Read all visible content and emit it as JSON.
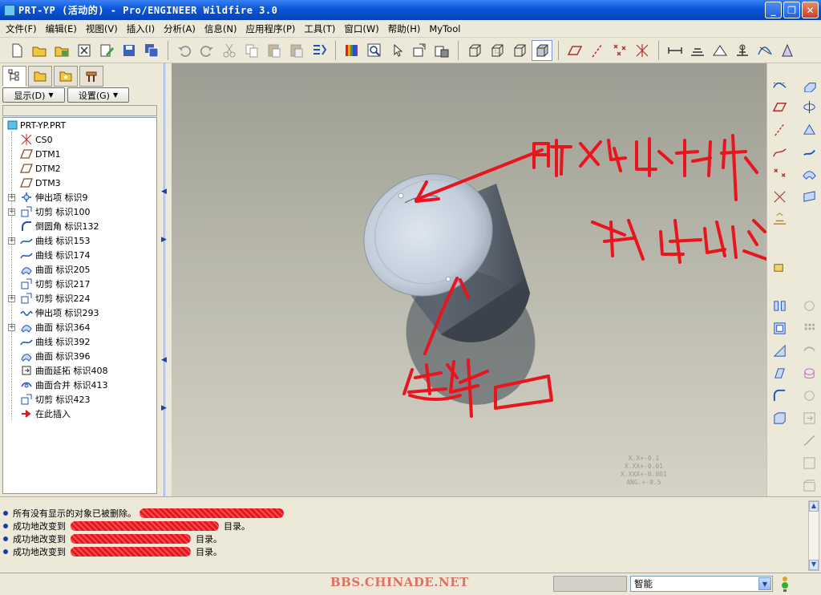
{
  "window": {
    "title": "PRT-YP (活动的) - Pro/ENGINEER Wildfire 3.0"
  },
  "menu": [
    "文件(F)",
    "编辑(E)",
    "视图(V)",
    "插入(I)",
    "分析(A)",
    "信息(N)",
    "应用程序(P)",
    "工具(T)",
    "窗口(W)",
    "帮助(H)",
    "MyTool"
  ],
  "panel": {
    "show_label": "显示(D)",
    "settings_label": "设置(G)"
  },
  "tree": [
    {
      "label": "PRT-YP.PRT",
      "icon": "part-icon",
      "root": true,
      "expandable": false
    },
    {
      "label": "CS0",
      "icon": "csys-icon",
      "expandable": false
    },
    {
      "label": "DTM1",
      "icon": "datum-plane-icon",
      "expandable": false
    },
    {
      "label": "DTM2",
      "icon": "datum-plane-icon",
      "expandable": false
    },
    {
      "label": "DTM3",
      "icon": "datum-plane-icon",
      "expandable": false
    },
    {
      "label": "伸出项 标识9",
      "icon": "protrusion-icon",
      "expandable": true
    },
    {
      "label": "切剪 标识100",
      "icon": "cut-icon",
      "expandable": true
    },
    {
      "label": "倒圆角 标识132",
      "icon": "round-icon",
      "expandable": false
    },
    {
      "label": "曲线 标识153",
      "icon": "curve-icon",
      "expandable": true
    },
    {
      "label": "曲线 标识174",
      "icon": "curve-icon",
      "expandable": false
    },
    {
      "label": "曲面 标识205",
      "icon": "surface-icon",
      "expandable": false
    },
    {
      "label": "切剪 标识217",
      "icon": "cut-icon",
      "expandable": false
    },
    {
      "label": "切剪 标识224",
      "icon": "cut-icon",
      "expandable": true
    },
    {
      "label": "伸出项 标识293",
      "icon": "sweep-icon",
      "expandable": false
    },
    {
      "label": "曲面 标识364",
      "icon": "surface-icon",
      "expandable": true
    },
    {
      "label": "曲线 标识392",
      "icon": "curve-icon",
      "expandable": false
    },
    {
      "label": "曲面 标识396",
      "icon": "surface-icon",
      "expandable": false
    },
    {
      "label": "曲面延拓 标识408",
      "icon": "extend-icon",
      "expandable": false
    },
    {
      "label": "曲面合并 标识413",
      "icon": "merge-icon",
      "expandable": false
    },
    {
      "label": "切剪 标识423",
      "icon": "cut-icon",
      "expandable": false
    },
    {
      "label": "在此插入",
      "icon": "insert-here-icon",
      "expandable": false
    }
  ],
  "viewport": {
    "tolerances": [
      "X.X+-0.1",
      "X.XX+-0.01",
      "X.XXX+-0.001",
      "ANG.+-0.5"
    ]
  },
  "messages": [
    "所有没有显示的对象已被删除。",
    "成功地改变到",
    "成功地改变到",
    "成功地改变到"
  ],
  "message_tails": [
    "",
    "目录。",
    "目录。",
    "目录。"
  ],
  "status": {
    "watermark": "BBS.CHINADE.NET",
    "filter_value": "智能"
  },
  "colors": {
    "model": "#8c96a0",
    "annotation": "#e8141e",
    "titlebar": "#0a56d8"
  }
}
